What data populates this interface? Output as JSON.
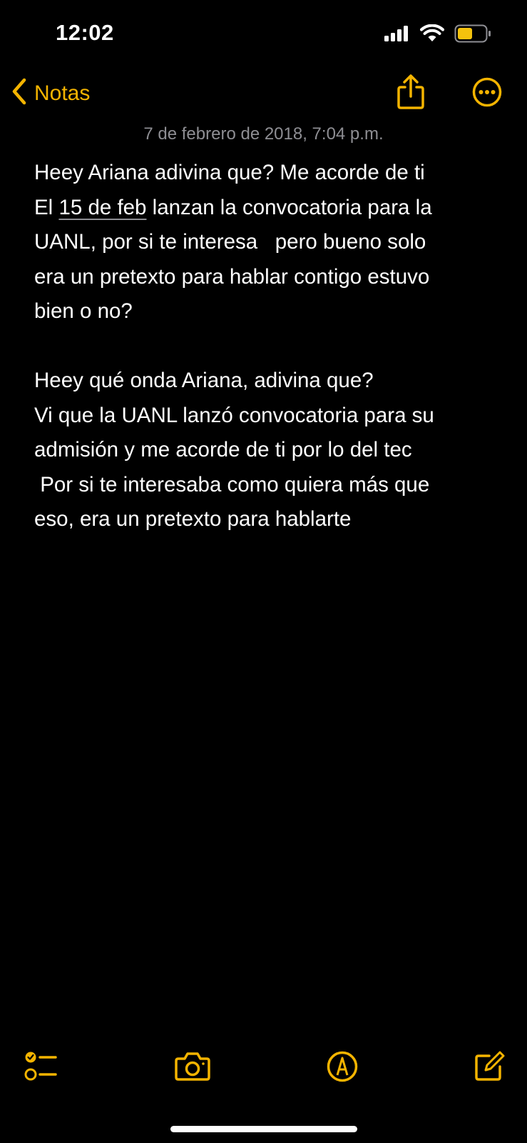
{
  "status_bar": {
    "time": "12:02",
    "icons": [
      "cellular-signal-icon",
      "wifi-icon",
      "battery-icon"
    ],
    "battery_color": "#f4c20d"
  },
  "nav": {
    "back_label": "Notas",
    "share_icon": "share-icon",
    "more_icon": "ellipsis-circle-icon",
    "accent_color": "#f4b400"
  },
  "note": {
    "date": "7 de febrero de 2018, 7:04 p.m.",
    "lines": [
      "Heey Ariana adivina que? Me acorde de ti",
      "El ",
      "15 de feb",
      " lanzan la convocatoria para la",
      "UANL, por si te interesa   pero bueno solo",
      "era un pretexto para hablar contigo estuvo",
      "bien o no?",
      "",
      "Heey qué onda Ariana, adivina que?",
      "Vi que la UANL lanzó convocatoria para su",
      "admisión y me acorde de ti por lo del tec",
      " Por si te interesaba como quiera más que",
      "eso, era un pretexto para hablarte"
    ]
  },
  "toolbar": {
    "icons": [
      "checklist-icon",
      "camera-icon",
      "markup-icon",
      "compose-icon"
    ]
  }
}
